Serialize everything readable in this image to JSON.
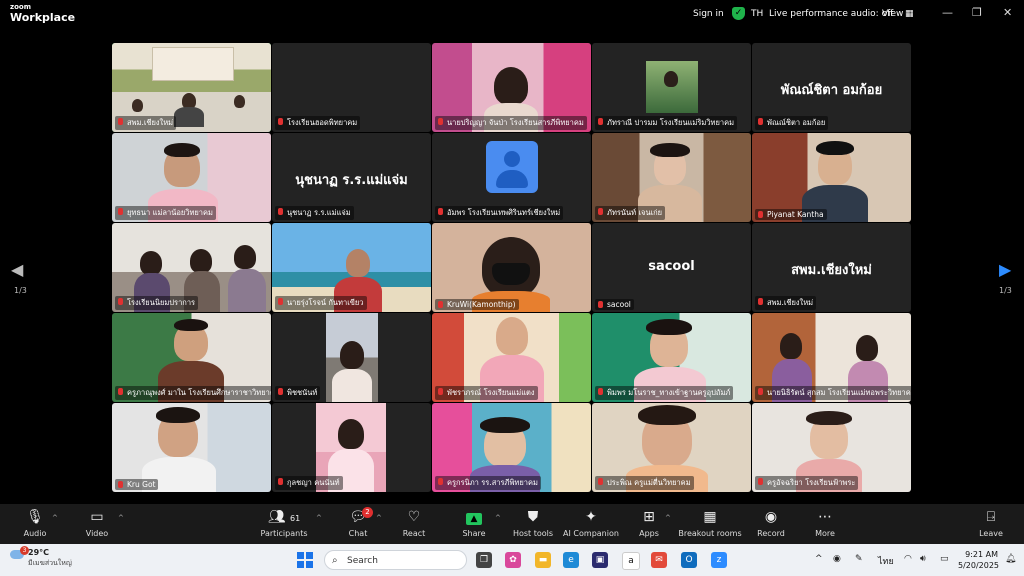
{
  "app": {
    "brand_top": "zoom",
    "brand_bottom": "Workplace"
  },
  "topbar": {
    "sign_in": "Sign in",
    "user_initials": "TH",
    "audio_status": "Live performance audio: off",
    "view": "View"
  },
  "pagination": {
    "left": "1/3",
    "right": "1/3"
  },
  "participants": [
    {
      "name": "สพม.เชียงใหม่",
      "type": "video",
      "active": true
    },
    {
      "name": "โรงเรียนฮอดพิทยาคม",
      "type": "blank"
    },
    {
      "name": "นายปริญญา จันป่า โรงเรียนสารภีพิทยาคม",
      "type": "video"
    },
    {
      "name": "ภัทราณี ปารมม โรงเรียนแม่ริมวิทยาคม",
      "type": "photo"
    },
    {
      "name": "พัณณ์ชิตา อมก้อย",
      "type": "name",
      "display": "พัณณ์ชิตา อมก้อย"
    },
    {
      "name": "ยุทธนา แม่ลาน้อยวิทยาคม",
      "type": "video"
    },
    {
      "name": "นุชนาฏ ร.ร.แม่แจ่ม",
      "type": "name",
      "display": "นุชนาฏ ร.ร.แม่แจ่ม"
    },
    {
      "name": "อัมพร โรงเรียนเทพศิรินทร์เชียงใหม่",
      "type": "avatar"
    },
    {
      "name": "ภัทรนันท์ เจนเก่ย",
      "type": "video"
    },
    {
      "name": "Piyanat Kantha",
      "type": "video"
    },
    {
      "name": "โรงเรียนนิยมปราการ",
      "type": "video"
    },
    {
      "name": "นายรุ่งโรจน์ กันทาเขียว",
      "type": "video"
    },
    {
      "name": "KruWi(Kamonthip)",
      "type": "video"
    },
    {
      "name": "sacool",
      "type": "name",
      "display": "sacool"
    },
    {
      "name": "สพม.เชียงใหม่",
      "type": "name",
      "display": "สพม.เชียงใหม่"
    },
    {
      "name": "ครูภาณุพงศ์ มาใน โรงเรียนศึกษาราชาวิทยาคม",
      "type": "video"
    },
    {
      "name": "พิชชนันท์",
      "type": "video"
    },
    {
      "name": "พัชราภรณ์ โรงเรียนแม่แตง",
      "type": "video"
    },
    {
      "name": "พิมพร มโนราช_ทางเข้าฐานครูอุปถัมภ์",
      "type": "video"
    },
    {
      "name": "นายนิธิรัตน์ สุกสม โรงเรียนแม่ทอพระวิทยาคม",
      "type": "video"
    },
    {
      "name": "Kru Got",
      "type": "video"
    },
    {
      "name": "กุลชญา คนนันท์",
      "type": "video"
    },
    {
      "name": "ครูกรนิภา รร.สารภีพิทยาคม",
      "type": "video"
    },
    {
      "name": "ประพิณ ครูแม่ตื่นวิทยาคม",
      "type": "video"
    },
    {
      "name": "ครูอัจฉริยา โรงเรียนฟ้าพระ",
      "type": "video"
    }
  ],
  "toolbar": {
    "audio": "Audio",
    "video": "Video",
    "participants": "Participants",
    "participants_count": "61",
    "chat": "Chat",
    "chat_badge": "2",
    "react": "React",
    "share": "Share",
    "host_tools": "Host tools",
    "ai_companion": "AI Companion",
    "apps": "Apps",
    "breakout_rooms": "Breakout rooms",
    "record": "Record",
    "more": "More",
    "leave": "Leave"
  },
  "taskbar": {
    "temperature": "29°C",
    "weather_desc": "มีเมฆส่วนใหญ่",
    "weather_badge": "3",
    "search_placeholder": "Search",
    "lang": "ไทย",
    "time": "9:21 AM",
    "date": "5/20/2025"
  },
  "colors": {
    "active_border": "#2fd163",
    "toolbar_bg": "#1a1a1a",
    "share_green": "#22c55e",
    "leave_red": "#ff5a5a"
  }
}
